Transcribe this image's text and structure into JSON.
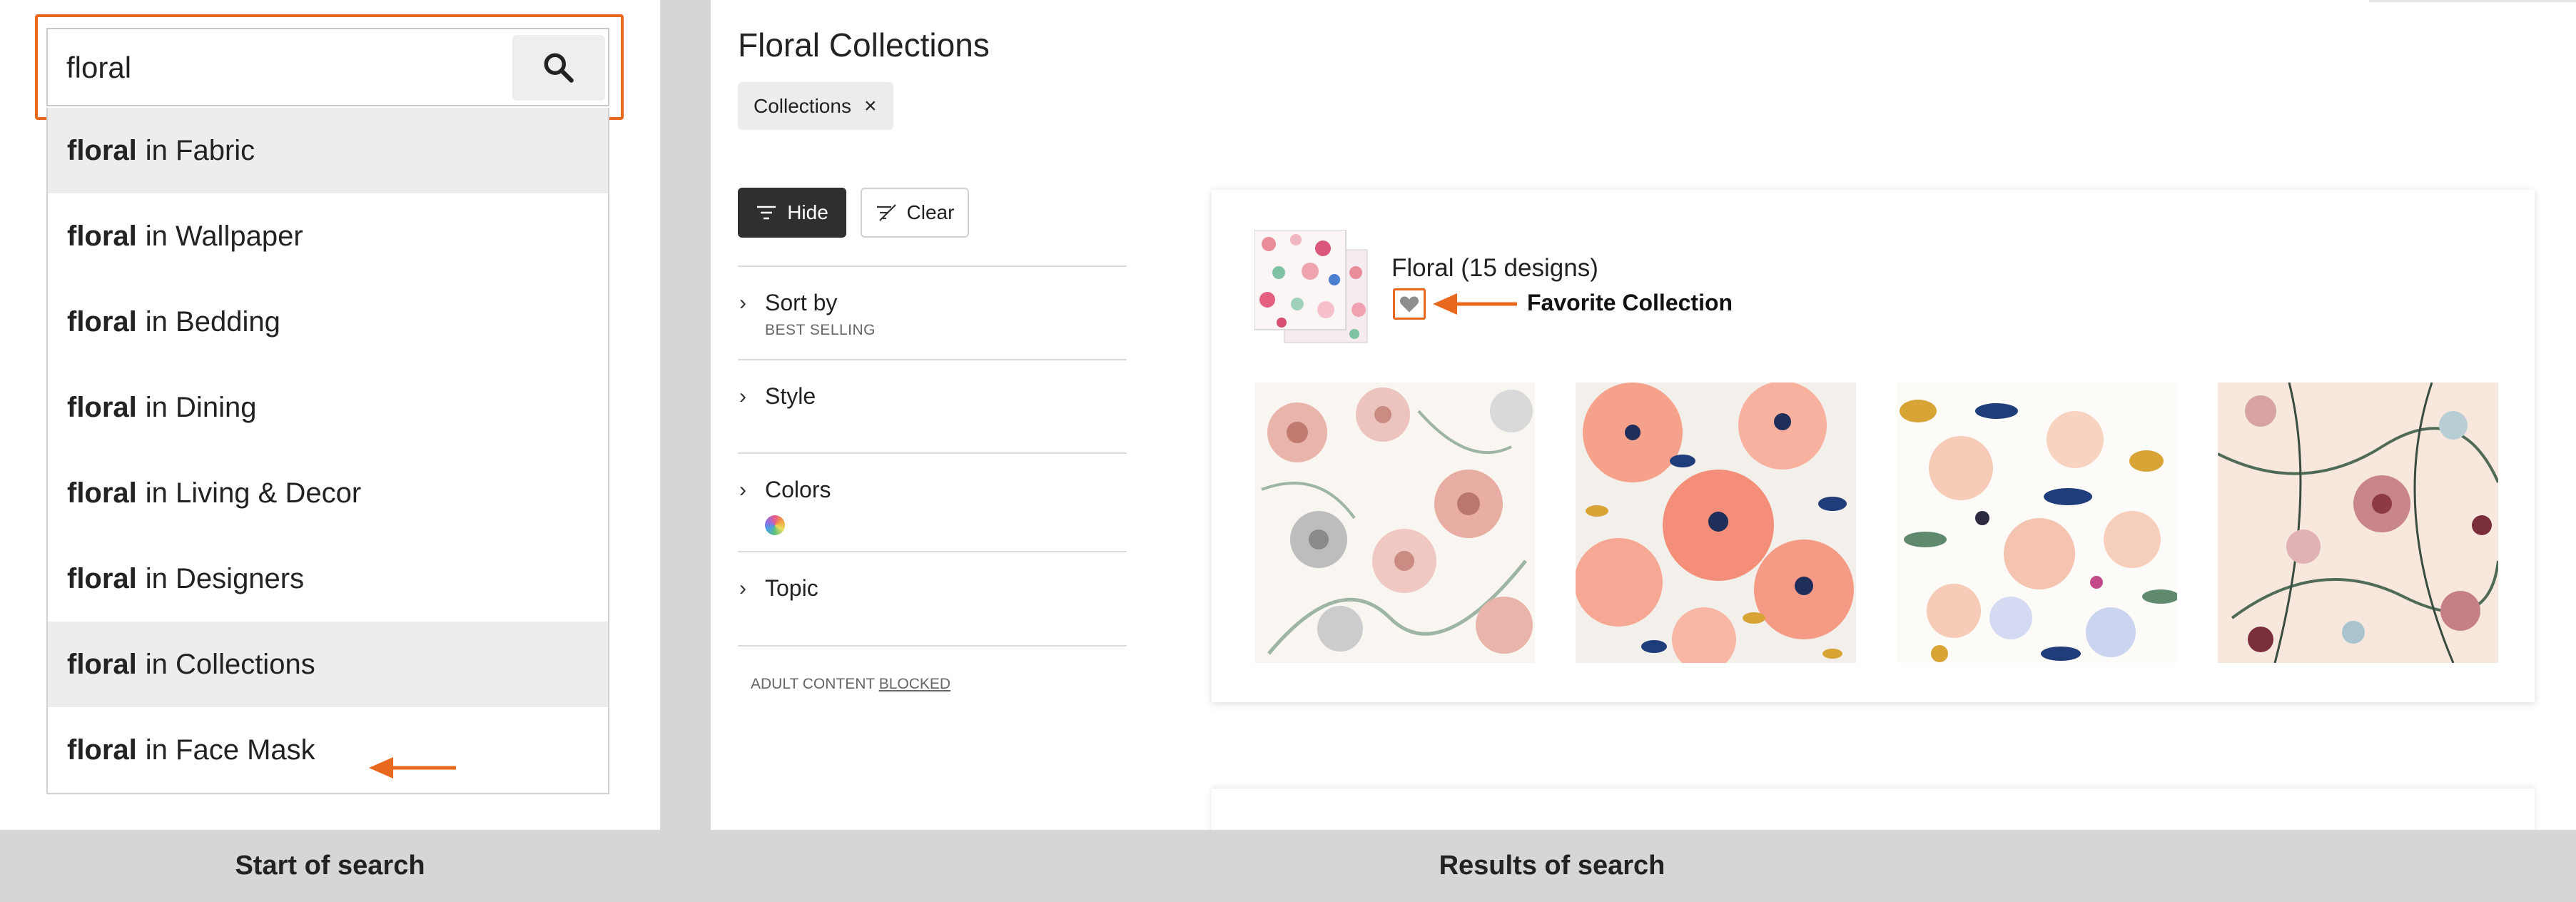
{
  "search": {
    "query": "floral",
    "button_icon": "search-icon"
  },
  "suggestions": [
    {
      "term": "floral",
      "suffix": "in Fabric"
    },
    {
      "term": "floral",
      "suffix": "in Wallpaper"
    },
    {
      "term": "floral",
      "suffix": "in Bedding"
    },
    {
      "term": "floral",
      "suffix": "in Dining"
    },
    {
      "term": "floral",
      "suffix": "in Living & Decor"
    },
    {
      "term": "floral",
      "suffix": "in Designers"
    },
    {
      "term": "floral",
      "suffix": "in Collections"
    },
    {
      "term": "floral",
      "suffix": "in Face Mask"
    }
  ],
  "results": {
    "title": "Floral Collections",
    "chip_label": "Collections",
    "chip_close": "×",
    "hide_label": "Hide",
    "clear_label": "Clear",
    "filters": [
      {
        "label": "Sort by",
        "sub": "BEST SELLING"
      },
      {
        "label": "Style",
        "sub": ""
      },
      {
        "label": "Colors",
        "sub": ""
      },
      {
        "label": "Topic",
        "sub": ""
      }
    ],
    "adult_prefix": "ADULT CONTENT",
    "adult_link": "BLOCKED",
    "collection": {
      "name": "Floral (15 designs)",
      "annotation": "Favorite Collection"
    }
  },
  "captions": {
    "left": "Start of search",
    "right": "Results of search"
  },
  "colors": {
    "accent_orange": "#e8691e",
    "dark_button": "#2f2f2f",
    "highlight_row": "#ededed"
  }
}
